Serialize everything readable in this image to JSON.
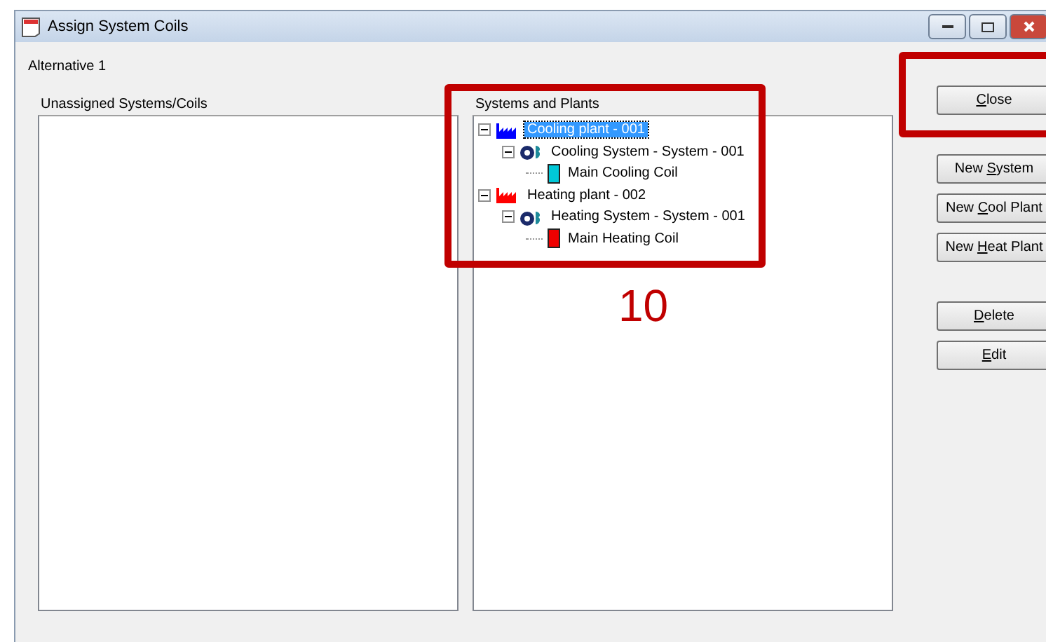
{
  "window": {
    "title": "Assign System Coils"
  },
  "alternative": "Alternative 1",
  "unassigned": {
    "label": "Unassigned Systems/Coils"
  },
  "tree": {
    "label": "Systems and Plants",
    "items": [
      {
        "kind": "plant",
        "label": "Cooling plant - 001",
        "color": "#0000ff",
        "selected": true,
        "expanded": true,
        "children": [
          {
            "kind": "system",
            "label": "Cooling System - System - 001",
            "selected": false,
            "expanded": true,
            "children": [
              {
                "kind": "coil",
                "label": "Main Cooling Coil",
                "color": "#00c8d8",
                "selected": false
              }
            ]
          }
        ]
      },
      {
        "kind": "plant",
        "label": "Heating plant - 002",
        "color": "#ff0000",
        "selected": false,
        "expanded": true,
        "children": [
          {
            "kind": "system",
            "label": "Heating System - System - 001",
            "selected": false,
            "expanded": true,
            "children": [
              {
                "kind": "coil",
                "label": "Main Heating Coil",
                "color": "#ee0000",
                "selected": false
              }
            ]
          }
        ]
      }
    ]
  },
  "button_groups": [
    [
      {
        "mnemonic": "C",
        "rest": "lose"
      }
    ],
    [
      {
        "before": "New ",
        "mnemonic": "S",
        "rest": "ystem"
      },
      {
        "before": "New ",
        "mnemonic": "C",
        "rest": "ool Plant"
      },
      {
        "before": "New ",
        "mnemonic": "H",
        "rest": "eat Plant"
      }
    ],
    [
      {
        "mnemonic": "D",
        "rest": "elete"
      },
      {
        "mnemonic": "E",
        "rest": "dit"
      }
    ]
  ],
  "annotation": {
    "number": "10"
  }
}
